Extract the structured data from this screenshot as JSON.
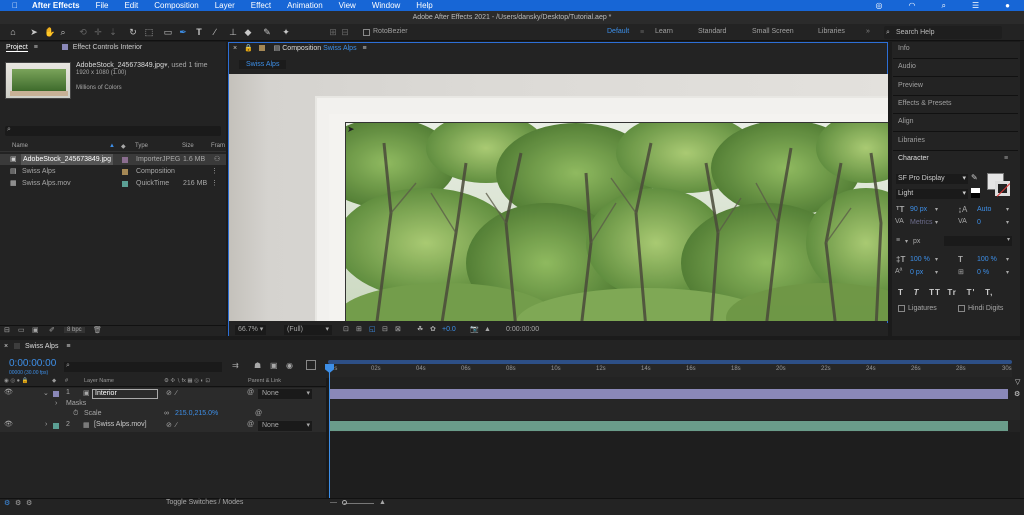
{
  "menubar": {
    "app": "After Effects",
    "items": [
      "File",
      "Edit",
      "Composition",
      "Layer",
      "Effect",
      "Animation",
      "View",
      "Window",
      "Help"
    ]
  },
  "window_title": "Adobe After Effects 2021 - /Users/dansky/Desktop/Tutorial.aep *",
  "toolbar": {
    "rotobezier": "RotoBezier",
    "workspaces": [
      "Default",
      "Learn",
      "Standard",
      "Small Screen",
      "Libraries"
    ],
    "active_ws": "Default",
    "search_help": "Search Help"
  },
  "project": {
    "tab_project": "Project",
    "tab_effect": "Effect Controls Interior",
    "asset_name": "AdobeStock_245673849.jpg",
    "asset_used": ", used 1 time",
    "asset_dims": "1920 x 1080 (1.00)",
    "asset_colors": "Millions of Colors",
    "col_name": "Name",
    "col_type": "Type",
    "col_size": "Size",
    "col_frame": "Fram",
    "items": [
      {
        "name": "AdobeStock_245673849.jpg",
        "type": "ImporterJPEG",
        "size": "1.6 MB",
        "color": "#8a6d8f"
      },
      {
        "name": "Swiss Alps",
        "type": "Composition",
        "size": "",
        "color": "#a58855"
      },
      {
        "name": "Swiss Alps.mov",
        "type": "QuickTime",
        "size": "216 MB",
        "color": "#5b9f94"
      }
    ],
    "bpc": "8 bpc"
  },
  "composition": {
    "label": "Composition",
    "name": "Swiss Alps",
    "tab": "Swiss Alps",
    "zoom": "66.7%",
    "res": "(Full)",
    "exposure": "+0.0",
    "timecode": "0:00:00:00"
  },
  "right_panel": {
    "items": [
      "Info",
      "Audio",
      "Preview",
      "Effects & Presets",
      "Align",
      "Libraries"
    ],
    "character": "Character",
    "font": "SF Pro Display",
    "style": "Light",
    "size": "90 px",
    "leading": "Auto",
    "kerning": "Metrics",
    "tracking": "0",
    "stroke_unit": "px",
    "vscale": "100 %",
    "hscale": "100 %",
    "baseline": "0 px",
    "tsume": "0 %",
    "styles": [
      "T",
      "T",
      "TT",
      "Tr",
      "T'",
      "T,"
    ],
    "ligatures": "Ligatures",
    "hindi": "Hindi Digits"
  },
  "timeline": {
    "tab": "Swiss Alps",
    "time": "0:00:00:00",
    "fps": "00000 (30.00 fps)",
    "col_layer": "Layer Name",
    "col_parent": "Parent & Link",
    "layers": [
      {
        "num": "1",
        "name": "Interior",
        "parent": "None",
        "color": "#8a88b8"
      },
      {
        "num": "2",
        "name": "[Swiss Alps.mov]",
        "parent": "None",
        "color": "#5b9f94"
      }
    ],
    "masks": "Masks",
    "scale_label": "Scale",
    "scale_value": "215.0,215.0%",
    "ticks": [
      "0s",
      "02s",
      "04s",
      "06s",
      "08s",
      "10s",
      "12s",
      "14s",
      "16s",
      "18s",
      "20s",
      "22s",
      "24s",
      "26s",
      "28s",
      "30s"
    ],
    "toggle": "Toggle Switches / Modes"
  },
  "colors": {
    "accent": "#1766d6",
    "layer1": "#8a88b8",
    "layer2": "#6a9c8a"
  }
}
